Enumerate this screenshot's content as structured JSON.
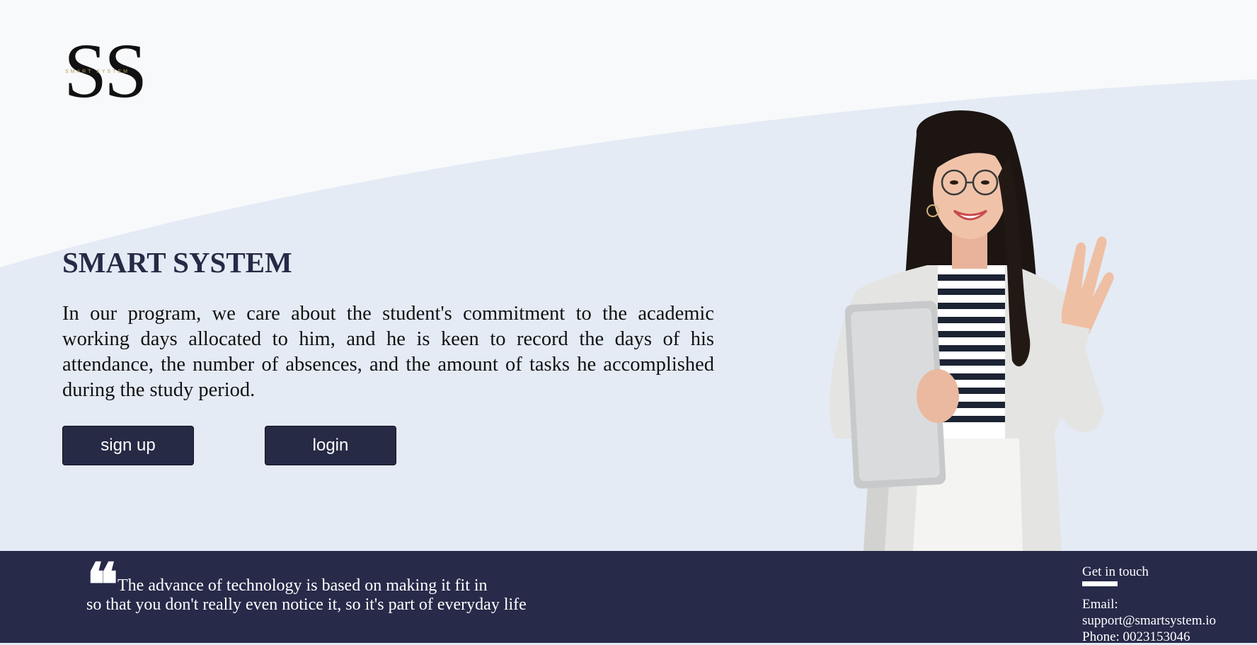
{
  "logo": {
    "letters": "SS",
    "tagline": "SMART SYSTEM"
  },
  "hero": {
    "title": "SMART SYSTEM",
    "description": "In our program, we care about the student's commitment to the academic working days allocated to him, and he is keen to record the days of his attendance, the number of absences, and the amount of tasks he accomplished during the study period.",
    "signup_label": "sign up",
    "login_label": "login"
  },
  "footer": {
    "quote_icon": "quote-icon",
    "quote_line1": "The advance of technology is based on making it fit in",
    "quote_line2": "so that you don't really even notice it, so it's part of everyday life",
    "contact_heading": "Get in touch",
    "email_label": "Email:",
    "email_value": "support@smartsystem.io",
    "phone": "Phone: 0023153046"
  },
  "colors": {
    "navy": "#272a45",
    "background": "#e4ebf5",
    "top_wave": "#f8f9fb"
  }
}
